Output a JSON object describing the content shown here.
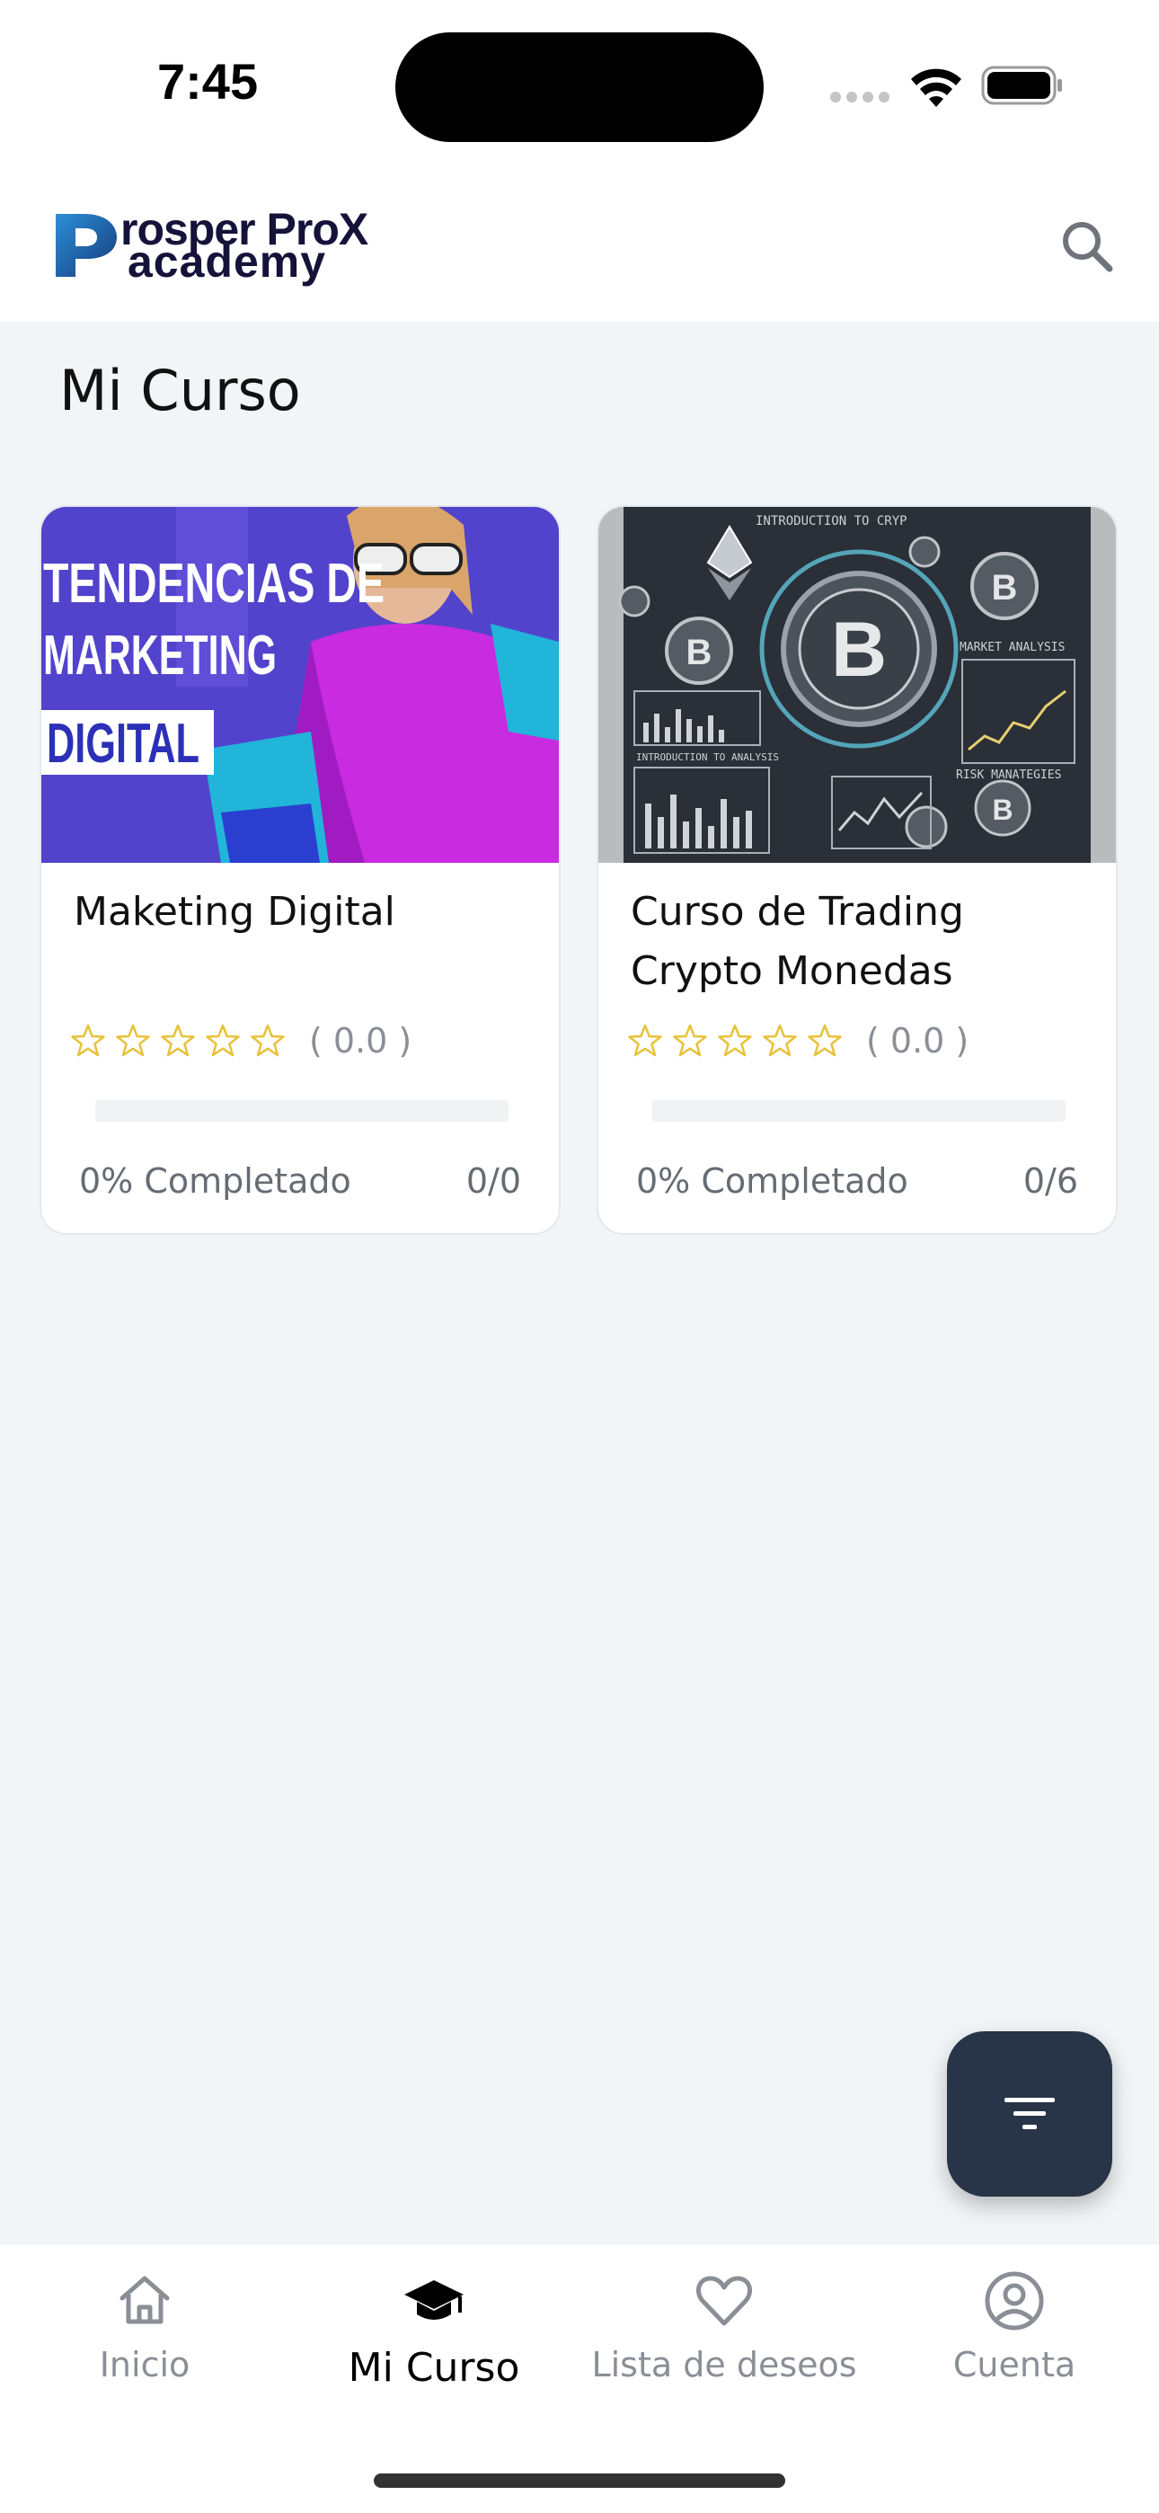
{
  "status_bar": {
    "time": "7:45"
  },
  "header": {
    "logo_line1": "rosper ProX",
    "logo_line2": "academy",
    "search_icon": "search-icon"
  },
  "page": {
    "title": "Mi Curso"
  },
  "courses": [
    {
      "title": "Maketing Digital",
      "thumbnail_text": [
        "TENDENCIAS DE",
        "MARKETING",
        "DIGITAL"
      ],
      "stars": 0,
      "rating": "( 0.0 )",
      "progress": 0,
      "progress_label": "0% Completado",
      "lessons": "0/0"
    },
    {
      "title": "Curso de Trading Crypto Monedas",
      "thumbnail_text": [
        "INTRODUCTION TO CRYP",
        "MARKET ANALYSIS",
        "INTRODUCTION TO ANALYSIS",
        "RISK MANATEGIES"
      ],
      "stars": 0,
      "rating": "( 0.0 )",
      "progress": 0,
      "progress_label": "0% Completado",
      "lessons": "0/6"
    }
  ],
  "fab": {
    "icon": "filter-icon"
  },
  "bottom_nav": [
    {
      "label": "Inicio",
      "icon": "home-icon",
      "active": false
    },
    {
      "label": "Mi Curso",
      "icon": "graduation-cap-icon",
      "active": true
    },
    {
      "label": "Lista de deseos",
      "icon": "heart-icon",
      "active": false
    },
    {
      "label": "Cuenta",
      "icon": "account-icon",
      "active": false
    }
  ],
  "colors": {
    "background": "#f2f5f7",
    "fab": "#283548",
    "star": "#e8c23a",
    "logo": "#15133a"
  }
}
